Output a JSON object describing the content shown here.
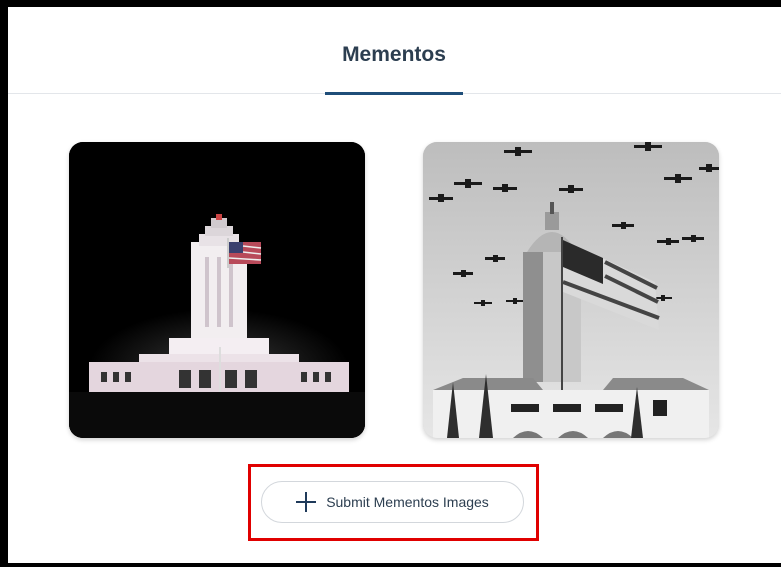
{
  "tabs": [
    {
      "label": "Mementos",
      "active": true
    }
  ],
  "gallery": {
    "images": [
      {
        "alt": "Tower building illuminated at night with flag"
      },
      {
        "alt": "Black and white photo of tower with flag and aircraft formation"
      }
    ]
  },
  "actions": {
    "submit_label": "Submit Mementos Images",
    "submit_icon": "plus-icon"
  },
  "colors": {
    "accent": "#1f4e79",
    "highlight": "#e00000",
    "text": "#2c3e50"
  }
}
